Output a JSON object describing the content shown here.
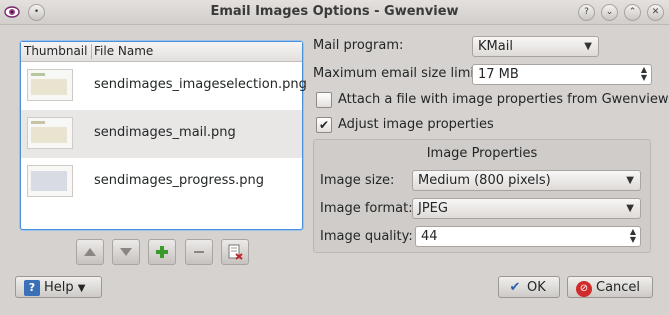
{
  "window": {
    "title": "Email Images Options - Gwenview",
    "buttons": [
      "?",
      "v",
      "^",
      "x"
    ]
  },
  "file_list": {
    "columns": [
      "Thumbnail",
      "File Name"
    ],
    "files": [
      "sendimages_imageselection.png",
      "sendimages_mail.png",
      "sendimages_progress.png"
    ]
  },
  "form": {
    "mail_program_label": "Mail program:",
    "mail_program_value": "KMail",
    "max_size_label": "Maximum email size limit:",
    "max_size_value": "17 MB",
    "attach_label": "Attach a file with image properties from Gwenview",
    "attach_checked": false,
    "adjust_label": "Adjust image properties",
    "adjust_checked": true
  },
  "image_properties": {
    "title": "Image Properties",
    "size_label": "Image size:",
    "size_value": "Medium (800 pixels)",
    "format_label": "Image format:",
    "format_value": "JPEG",
    "quality_label": "Image quality:",
    "quality_value": "44"
  },
  "buttons": {
    "help": "Help",
    "ok": "OK",
    "cancel": "Cancel"
  }
}
